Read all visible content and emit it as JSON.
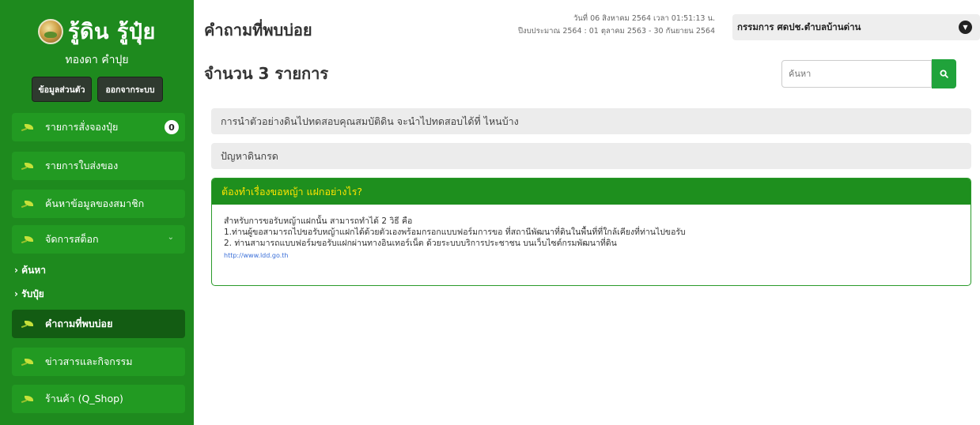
{
  "sidebar": {
    "logo_text": "รู้ดิน รู้ปุ๋ย",
    "user_name": "ทองดา คำปุย",
    "profile_button": "ข้อมูลส่วนตัว",
    "logout_button": "ออกจากระบบ",
    "items": [
      {
        "label": "รายการสั่งจองปุ๋ย",
        "badge": "0"
      },
      {
        "label": "รายการใบส่งของ"
      },
      {
        "label": "ค้นหาข้อมูลของสมาชิก"
      },
      {
        "label": "จัดการสต็อก"
      },
      {
        "label": "คำถามที่พบบ่อย"
      },
      {
        "label": "ข่าวสารและกิจกรรม"
      },
      {
        "label": "ร้านค้า (Q_Shop)"
      }
    ],
    "submenu": [
      "› ค้นหา",
      "› รับปุ๋ย"
    ]
  },
  "header": {
    "title": "คำถามที่พบบ่อย",
    "date_line": "วันที่ 06 สิงหาคม 2564 เวลา 01:51:13 น.",
    "fiscal_line": "ปีงบประมาณ 2564 : 01 ตุลาคม 2563 - 30 กันยายน 2564",
    "role": "กรรมการ ศดปช.ตำบลบ้านด่าน"
  },
  "main": {
    "count_text": "จำนวน 3 รายการ",
    "search_placeholder": "ค้นหา",
    "faqs": [
      {
        "question": "การนำตัวอย่างดินไปทดสอบคุณสมบัติดิน จะนำไปทดสอบได้ที่ ไหนบ้าง"
      },
      {
        "question": "ปัญหาดินกรด"
      },
      {
        "question": "ต้องทำเรื่องขอหญ้า แฝกอย่างไร?",
        "answer": [
          "สำหรับการขอรับหญ้าแฝกนั้น สามารถทำได้ 2 วิธี คือ",
          "1.ท่านผู้ขอสามารถไปขอรับหญ้าแฝกได้ด้วยตัวเองพร้อมกรอกแบบฟอร์มการขอ ที่สถานีพัฒนาที่ดินในพื้นที่ที่ใกล้เคียงที่ท่านไปขอรับ",
          "2. ท่านสามารถแบบฟอร์มขอรับแฝกผ่านทางอินเทอร์เน็ต ด้วยระบบบริการประชาชน บนเว็บไซต์กรมพัฒนาที่ดิน"
        ],
        "link": "http://www.ldd.go.th"
      }
    ]
  },
  "colors": {
    "sidebar": "#1e8a1e",
    "menu_item": "#229a22",
    "menu_active": "#135c13",
    "faq_open_header": "#1e8f1e",
    "faq_open_text": "#ffe400",
    "search_button": "#20a33b"
  }
}
